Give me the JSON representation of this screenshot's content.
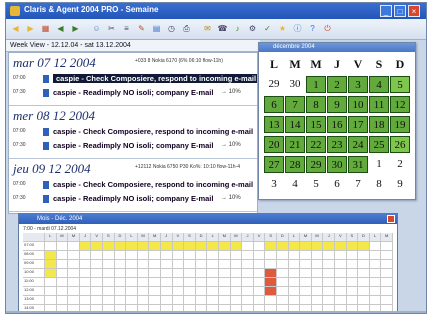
{
  "window": {
    "title": "Claris & Agent 2004 PRO - Semaine"
  },
  "toolbar": {
    "buttons": [
      {
        "icon": "back-icon",
        "glyph": "◀",
        "color": "#e8b631"
      },
      {
        "icon": "forward-icon",
        "glyph": "▶",
        "color": "#e8b631"
      },
      {
        "icon": "grid-icon",
        "glyph": "▦",
        "color": "#c44a2f"
      },
      {
        "icon": "prev-icon",
        "glyph": "◀",
        "color": "#3d7a2c"
      },
      {
        "icon": "next-icon",
        "glyph": "▶",
        "color": "#3d7a2c"
      },
      {
        "icon": "user-icon",
        "glyph": "☺",
        "color": "#5a7fc4"
      },
      {
        "icon": "cut-icon",
        "glyph": "✂",
        "color": "#446"
      },
      {
        "icon": "list-icon",
        "glyph": "≡",
        "color": "#446"
      },
      {
        "icon": "edit-icon",
        "glyph": "✎",
        "color": "#c44a2f"
      },
      {
        "icon": "calendar-icon",
        "glyph": "▤",
        "color": "#3a6fd0"
      },
      {
        "icon": "clock-icon",
        "glyph": "◷",
        "color": "#446"
      },
      {
        "icon": "print-icon",
        "glyph": "⎙",
        "color": "#446"
      },
      {
        "icon": "mail-icon",
        "glyph": "✉",
        "color": "#b58a24"
      },
      {
        "icon": "phone-icon",
        "glyph": "☎",
        "color": "#446"
      },
      {
        "icon": "note-icon",
        "glyph": "♪",
        "color": "#3d7a2c"
      },
      {
        "icon": "tools-icon",
        "glyph": "⚙",
        "color": "#446"
      },
      {
        "icon": "check-icon",
        "glyph": "✓",
        "color": "#3d7a2c"
      },
      {
        "icon": "star-icon",
        "glyph": "★",
        "color": "#e8b631"
      },
      {
        "icon": "info-icon",
        "glyph": "ⓘ",
        "color": "#3a6fd0"
      },
      {
        "icon": "help-icon",
        "glyph": "?",
        "color": "#3a6fd0"
      },
      {
        "icon": "exit-icon",
        "glyph": "⏻",
        "color": "#c44a2f"
      }
    ]
  },
  "week_bar": {
    "label": "Week View - 12.12.04 - sat 13.12.2004"
  },
  "days": [
    {
      "header": "mar 07 12 2004",
      "note": "+033 8 Nokia 6170 (6% 06:10 flow-11h)",
      "appointments": [
        {
          "time": "07:00",
          "text": "caspie - Check Composiere, respond to incoming e-mail",
          "end": "",
          "selected": true
        },
        {
          "time": "07:30",
          "text": "caspie - Readimply NO isoli; company E-mail",
          "end": "→ 10%",
          "selected": false
        }
      ]
    },
    {
      "header": "mer 08 12 2004",
      "note": "",
      "appointments": [
        {
          "time": "07:00",
          "text": "caspie - Check Composiere, respond to incoming e-mail",
          "end": "",
          "selected": false
        },
        {
          "time": "07:30",
          "text": "caspie - Readimply NO isoli; company E-mail",
          "end": "→ 10%",
          "selected": false
        }
      ]
    },
    {
      "header": "jeu 09 12 2004",
      "note": "+12112 Nokia 6750 P30 Ko%: 10:10 flow-11h-4",
      "appointments": [
        {
          "time": "07:00",
          "text": "caspie - Check Composiere, respond to incoming e-mail",
          "end": "",
          "selected": false
        },
        {
          "time": "07:30",
          "text": "caspie - Readimply NO isoli; company E-mail",
          "end": "→ 10%",
          "selected": false
        }
      ]
    }
  ],
  "calendar": {
    "title": "décembre 2004",
    "weekday_headers": [
      "L",
      "M",
      "M",
      "J",
      "V",
      "S",
      "D"
    ],
    "rows": [
      [
        {
          "d": "29",
          "s": "w"
        },
        {
          "d": "30",
          "s": "w"
        },
        {
          "d": "1",
          "s": "g"
        },
        {
          "d": "2",
          "s": "g"
        },
        {
          "d": "3",
          "s": "g"
        },
        {
          "d": "4",
          "s": "g"
        },
        {
          "d": "5",
          "s": "b"
        }
      ],
      [
        {
          "d": "6",
          "s": "g"
        },
        {
          "d": "7",
          "s": "g"
        },
        {
          "d": "8",
          "s": "g"
        },
        {
          "d": "9",
          "s": "g"
        },
        {
          "d": "10",
          "s": "g"
        },
        {
          "d": "11",
          "s": "g"
        },
        {
          "d": "12",
          "s": "g"
        }
      ],
      [
        {
          "d": "13",
          "s": "g"
        },
        {
          "d": "14",
          "s": "g"
        },
        {
          "d": "15",
          "s": "g"
        },
        {
          "d": "16",
          "s": "g"
        },
        {
          "d": "17",
          "s": "g"
        },
        {
          "d": "18",
          "s": "g"
        },
        {
          "d": "19",
          "s": "g"
        }
      ],
      [
        {
          "d": "20",
          "s": "g"
        },
        {
          "d": "21",
          "s": "g"
        },
        {
          "d": "22",
          "s": "g"
        },
        {
          "d": "23",
          "s": "g"
        },
        {
          "d": "24",
          "s": "g"
        },
        {
          "d": "25",
          "s": "g"
        },
        {
          "d": "26",
          "s": "b"
        }
      ],
      [
        {
          "d": "27",
          "s": "g"
        },
        {
          "d": "28",
          "s": "g"
        },
        {
          "d": "29",
          "s": "g"
        },
        {
          "d": "30",
          "s": "g"
        },
        {
          "d": "31",
          "s": "g"
        },
        {
          "d": "1",
          "s": "w"
        },
        {
          "d": "2",
          "s": "w"
        }
      ],
      [
        {
          "d": "3",
          "s": "w"
        },
        {
          "d": "4",
          "s": "w"
        },
        {
          "d": "5",
          "s": "w"
        },
        {
          "d": "6",
          "s": "w"
        },
        {
          "d": "7",
          "s": "w"
        },
        {
          "d": "8",
          "s": "w"
        },
        {
          "d": "9",
          "s": "w"
        }
      ]
    ],
    "colors": {
      "green": "#62aa3c",
      "bright_green": "#7fc64c",
      "border": "#1b4e12"
    }
  },
  "grid_window": {
    "title": "Mois - Déc. 2004",
    "subtitle": "7:00 - mardi 07.12.2004",
    "column_headers": [
      "L",
      "M",
      "M",
      "J",
      "V",
      "S",
      "D",
      "L",
      "M",
      "M",
      "J",
      "V",
      "S",
      "D",
      "L",
      "M",
      "M",
      "J",
      "V",
      "S",
      "D",
      "L",
      "M",
      "M",
      "J",
      "V",
      "S",
      "D",
      "L",
      "M"
    ],
    "row_labels": [
      "",
      "07:00",
      "08:00",
      "09:00",
      "10:00",
      "11:00",
      "12:00",
      "13:00",
      "14:00"
    ],
    "yellow_row0": [
      3,
      4,
      5,
      6,
      7,
      8,
      9,
      10,
      11,
      12,
      13,
      14,
      15,
      16,
      19,
      20,
      21,
      22,
      23,
      24,
      25,
      26,
      27
    ],
    "yellow_extra": [
      [
        2,
        0
      ],
      [
        3,
        0
      ],
      [
        4,
        0
      ]
    ],
    "red_cells": [
      [
        4,
        19
      ],
      [
        5,
        19
      ],
      [
        6,
        19
      ]
    ],
    "colors": {
      "yellow": "#f3e74a",
      "red": "#e05a3e"
    }
  }
}
